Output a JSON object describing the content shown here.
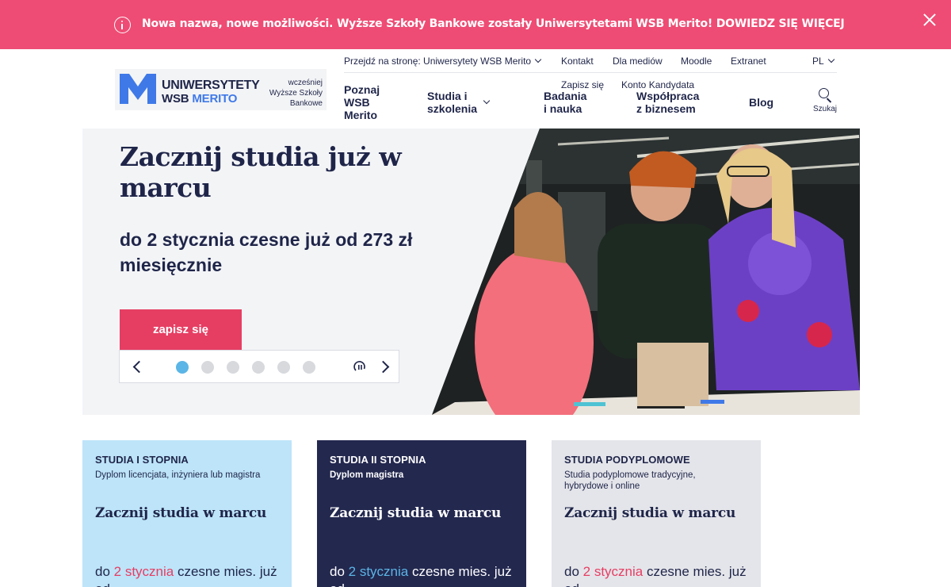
{
  "colors": {
    "banner_bg": "#ee4c74",
    "navy": "#1f2549",
    "brand_blue": "#3f79e8",
    "cta": "#e63e63",
    "dot_active": "#5bb5e6",
    "card1_bg": "#bde4f9",
    "card2_bg": "#23284f",
    "card3_bg": "#e4e5ea",
    "accent_red": "#e63e63",
    "accent_blue": "#5bb5e6"
  },
  "banner": {
    "icon": "info-icon",
    "text": "Nowa nazwa, nowe możliwości. Wyższe Szkoły Bankowe zostały Uniwersytetami WSB Merito! DOWIEDZ SIĘ WIĘCEJ",
    "close_icon": "close-icon"
  },
  "logo": {
    "line1": "UNIWERSYTETY",
    "line2a": "WSB",
    "line2b": "MERITO",
    "aside1": "wcześniej",
    "aside2": "Wyższe Szkoły",
    "aside3": "Bankowe"
  },
  "util_nav": {
    "goto": "Przejdź na stronę: Uniwersytety WSB Merito",
    "contact": "Kontakt",
    "media": "Dla mediów",
    "moodle": "Moodle",
    "extranet": "Extranet",
    "lang": "PL"
  },
  "main_nav": {
    "meet1": "Poznaj",
    "meet2": "WSB",
    "meet3": "Merito",
    "studies1": "Studia i",
    "studies2": "szkolenia",
    "signup": "Zapisz się",
    "candidate": "Konto Kandydata",
    "research1": "Badania",
    "research2": "i nauka",
    "business1": "Współpraca",
    "business2": "z biznesem",
    "blog": "Blog",
    "search": "Szukaj"
  },
  "hero": {
    "title": "Zacznij studia już w marcu",
    "subtitle": "do 2 stycznia czesne już od 273 zł miesięcznie",
    "cta": "zapisz się",
    "slides": 6,
    "active_slide": 1
  },
  "cards": [
    {
      "heading": "STUDIA I STOPNIA",
      "desc": "Dyplom licencjata, inżyniera lub magistra",
      "title": "Zacznij studia w marcu",
      "price_pre": "do ",
      "price_hl": "2 stycznia",
      "price_post": " czesne mies. już od"
    },
    {
      "heading": "STUDIA II STOPNIA",
      "desc": "Dyplom magistra",
      "title": "Zacznij studia w marcu",
      "price_pre": "do ",
      "price_hl": "2 stycznia",
      "price_post": " czesne mies. już od"
    },
    {
      "heading": "STUDIA PODYPLOMOWE",
      "desc": "Studia podyplomowe tradycyjne, hybrydowe i online",
      "title": "Zacznij studia w marcu",
      "price_pre": "do ",
      "price_hl": "2 stycznia",
      "price_post": " czesne mies. już od"
    }
  ]
}
